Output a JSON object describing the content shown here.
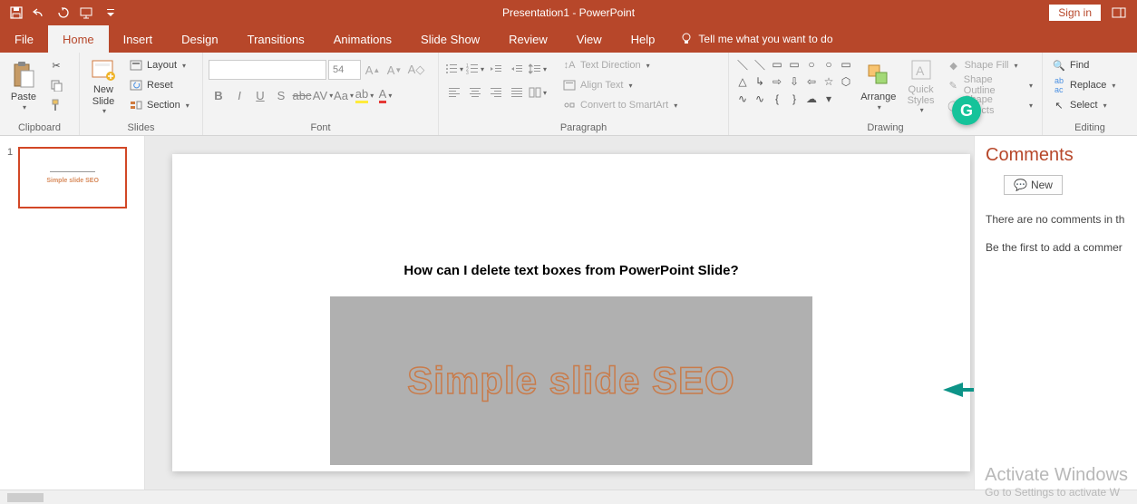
{
  "title": "Presentation1 - PowerPoint",
  "signin": "Sign in",
  "tabs": [
    "File",
    "Home",
    "Insert",
    "Design",
    "Transitions",
    "Animations",
    "Slide Show",
    "Review",
    "View",
    "Help"
  ],
  "activeTab": "Home",
  "tellme": "Tell me what you want to do",
  "groups": {
    "clipboard": {
      "label": "Clipboard",
      "paste": "Paste"
    },
    "slides": {
      "label": "Slides",
      "newSlide": "New\nSlide",
      "layout": "Layout",
      "reset": "Reset",
      "section": "Section"
    },
    "font": {
      "label": "Font",
      "size": "54"
    },
    "paragraph": {
      "label": "Paragraph",
      "textDirection": "Text Direction",
      "alignText": "Align Text",
      "convert": "Convert to SmartArt"
    },
    "drawing": {
      "label": "Drawing",
      "arrange": "Arrange",
      "quickStyles": "Quick\nStyles",
      "shapeFill": "Shape Fill",
      "shapeOutline": "Shape Outline",
      "shapeEffects": "Shape Effects"
    },
    "editing": {
      "label": "Editing",
      "find": "Find",
      "replace": "Replace",
      "select": "Select"
    }
  },
  "slidePanel": {
    "thumbNumber": "1",
    "thumbText": "Simple slide SEO"
  },
  "slide": {
    "heading": "How can I delete text boxes from PowerPoint Slide?",
    "bigText": "Simple slide SEO"
  },
  "comments": {
    "title": "Comments",
    "new": "New",
    "empty1": "There are no comments in th",
    "empty2": "Be the first to add a commer"
  },
  "watermark": {
    "title": "Activate Windows",
    "sub": "Go to Settings to activate W"
  }
}
